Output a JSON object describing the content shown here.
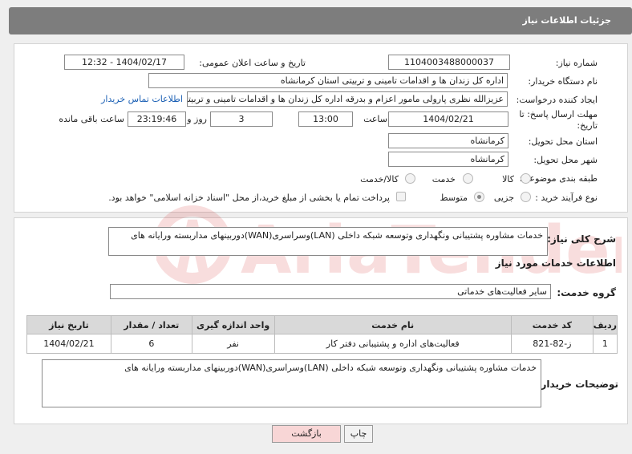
{
  "header_title": "جزئیات اطلاعات نیاز",
  "fields": {
    "need_number_label": "شماره نیاز:",
    "need_number": "1104003488000037",
    "announce_label": "تاریخ و ساعت اعلان عمومی:",
    "announce_value": "1404/02/17 - 12:32",
    "buyer_org_label": "نام دستگاه خریدار:",
    "buyer_org": "اداره کل زندان ها و اقدامات تامینی و تربیتی استان کرمانشاه",
    "requester_label": "ایجاد کننده درخواست:",
    "requester": "عزیزالله نظری پارولی مامور اعزام و بدرقه اداره کل زندان ها و اقدامات تامینی و تربیتی استان کرمانشاه",
    "contact_link": "اطلاعات تماس خریدار",
    "deadline_label": "مهلت ارسال پاسخ: تا تاریخ:",
    "deadline_date": "1404/02/21",
    "time_label": "ساعت",
    "deadline_time": "13:00",
    "days_value": "3",
    "days_label": "روز و",
    "remaining_time": "23:19:46",
    "remaining_label": "ساعت باقی مانده",
    "province_label": "استان محل تحویل:",
    "province": "کرمانشاه",
    "city_label": "شهر محل تحویل:",
    "city": "کرمانشاه",
    "category_label": "طبقه بندی موضوعی:",
    "category_options": [
      "کالا",
      "خدمت",
      "کالا/خدمت"
    ],
    "process_label": "نوع فرآیند خرید :",
    "process_options": [
      "جزیی",
      "متوسط"
    ],
    "payment_note": "پرداخت تمام یا بخشی از مبلغ خرید،از محل \"اسناد خزانه اسلامی\" خواهد بود."
  },
  "summary": {
    "label": "شرح کلی نیاز:",
    "text": "خدمات مشاوره پشتیبانی ونگهداری وتوسعه شبکه داخلی (LAN)وسراسری(WAN)دوربینهای مداربسته ورایانه های"
  },
  "services": {
    "section_title": "اطلاعات خدمات مورد نیاز",
    "group_label": "گروه خدمت:",
    "group_value": "سایر فعالیت‌های خدماتی",
    "columns": [
      "ردیف",
      "کد خدمت",
      "نام خدمت",
      "واحد اندازه گیری",
      "تعداد / مقدار",
      "تاریخ نیاز"
    ],
    "rows": [
      [
        "1",
        "ز-82-821",
        "فعالیت‌های اداره و پشتیبانی دفتر کار",
        "نفر",
        "6",
        "1404/02/21"
      ]
    ]
  },
  "buyer_notes": {
    "label": "توضیحات خریدار:",
    "text": "خدمات مشاوره پشتیبانی ونگهداری وتوسعه شبکه داخلی (LAN)وسراسری(WAN)دوربینهای مداربسته ورایانه های"
  },
  "buttons": {
    "print": "چاپ",
    "back": "بازگشت"
  },
  "colors": {
    "header": "#7d7d7d",
    "link": "#1a5fb4",
    "back_button": "#f8d6d6",
    "print_button": "#f2f2f2"
  }
}
